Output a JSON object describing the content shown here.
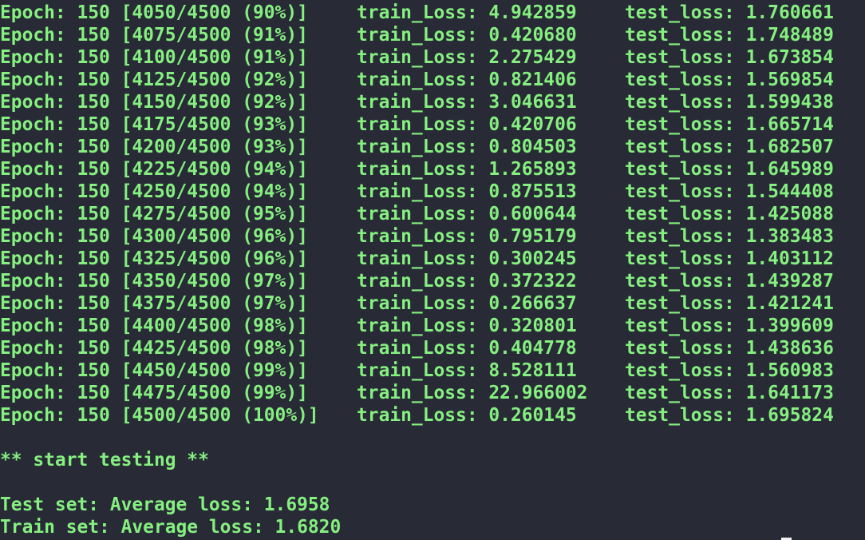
{
  "terminal": {
    "colors": {
      "background": "#282a36",
      "text": "#85f07f",
      "cursor": "#f2f2f2"
    },
    "log_lines": [
      {
        "epoch": "Epoch: 150 [4050/4500 (90%)]",
        "train": "train_Loss: 4.942859",
        "test": "test_loss: 1.760661"
      },
      {
        "epoch": "Epoch: 150 [4075/4500 (91%)]",
        "train": "train_Loss: 0.420680",
        "test": "test_loss: 1.748489"
      },
      {
        "epoch": "Epoch: 150 [4100/4500 (91%)]",
        "train": "train_Loss: 2.275429",
        "test": "test_loss: 1.673854"
      },
      {
        "epoch": "Epoch: 150 [4125/4500 (92%)]",
        "train": "train_Loss: 0.821406",
        "test": "test_loss: 1.569854"
      },
      {
        "epoch": "Epoch: 150 [4150/4500 (92%)]",
        "train": "train_Loss: 3.046631",
        "test": "test_loss: 1.599438"
      },
      {
        "epoch": "Epoch: 150 [4175/4500 (93%)]",
        "train": "train_Loss: 0.420706",
        "test": "test_loss: 1.665714"
      },
      {
        "epoch": "Epoch: 150 [4200/4500 (93%)]",
        "train": "train_Loss: 0.804503",
        "test": "test_loss: 1.682507"
      },
      {
        "epoch": "Epoch: 150 [4225/4500 (94%)]",
        "train": "train_Loss: 1.265893",
        "test": "test_loss: 1.645989"
      },
      {
        "epoch": "Epoch: 150 [4250/4500 (94%)]",
        "train": "train_Loss: 0.875513",
        "test": "test_loss: 1.544408"
      },
      {
        "epoch": "Epoch: 150 [4275/4500 (95%)]",
        "train": "train_Loss: 0.600644",
        "test": "test_loss: 1.425088"
      },
      {
        "epoch": "Epoch: 150 [4300/4500 (96%)]",
        "train": "train_Loss: 0.795179",
        "test": "test_loss: 1.383483"
      },
      {
        "epoch": "Epoch: 150 [4325/4500 (96%)]",
        "train": "train_Loss: 0.300245",
        "test": "test_loss: 1.403112"
      },
      {
        "epoch": "Epoch: 150 [4350/4500 (97%)]",
        "train": "train_Loss: 0.372322",
        "test": "test_loss: 1.439287"
      },
      {
        "epoch": "Epoch: 150 [4375/4500 (97%)]",
        "train": "train_Loss: 0.266637",
        "test": "test_loss: 1.421241"
      },
      {
        "epoch": "Epoch: 150 [4400/4500 (98%)]",
        "train": "train_Loss: 0.320801",
        "test": "test_loss: 1.399609"
      },
      {
        "epoch": "Epoch: 150 [4425/4500 (98%)]",
        "train": "train_Loss: 0.404778",
        "test": "test_loss: 1.438636"
      },
      {
        "epoch": "Epoch: 150 [4450/4500 (99%)]",
        "train": "train_Loss: 8.528111",
        "test": "test_loss: 1.560983"
      },
      {
        "epoch": "Epoch: 150 [4475/4500 (99%)]",
        "train": "train_Loss: 22.966002",
        "test": "test_loss: 1.641173"
      },
      {
        "epoch": "Epoch: 150 [4500/4500 (100%)]",
        "train": "train_Loss: 0.260145",
        "test": "test_loss: 1.695824"
      }
    ],
    "start_testing": "** start testing **",
    "test_summary": "Test set: Average loss: 1.6958",
    "train_summary": "Train set: Average loss: 1.6820"
  }
}
